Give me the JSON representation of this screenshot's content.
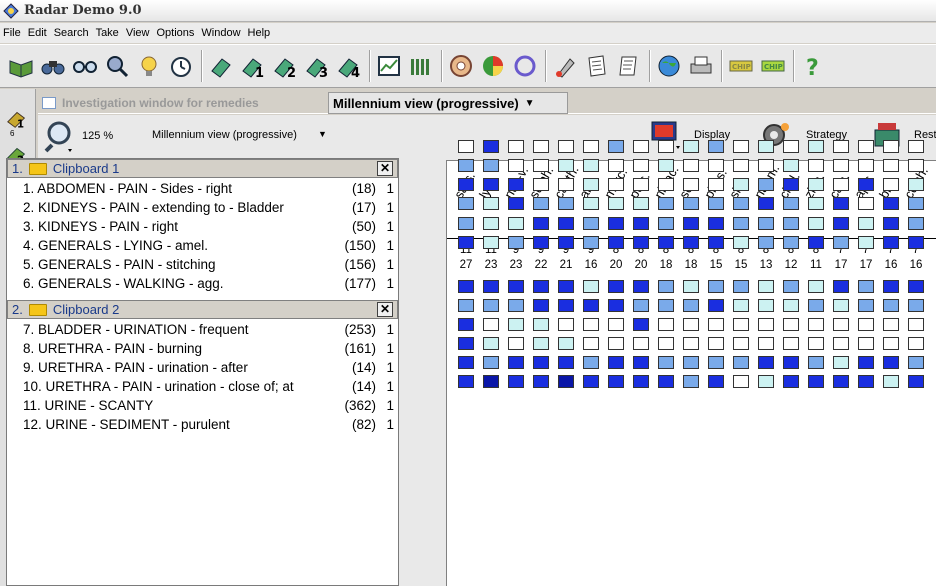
{
  "window": {
    "title": "Radar Demo 9.0"
  },
  "menu": [
    "File",
    "Edit",
    "Search",
    "Take",
    "View",
    "Options",
    "Window",
    "Help"
  ],
  "tabs": {
    "investigation": "Investigation window for remedies",
    "millennium": "Millennium view (progressive)"
  },
  "view": {
    "zoom": "125 %",
    "selector": "Millennium view (progressive)",
    "display_label": "Display",
    "strategy_label": "Strategy",
    "restrict_label": "Rest"
  },
  "leftbar": {
    "counts": [
      "6",
      "6"
    ],
    "numbers": [
      "1",
      "2",
      "3",
      "4",
      "5",
      "6",
      "7",
      "8",
      "9",
      "10"
    ]
  },
  "clipboards": [
    {
      "number": "1.",
      "name": "Clipboard 1",
      "close": "✕",
      "rubrics": [
        {
          "text": "1. ABDOMEN - PAIN - Sides - right",
          "count": "(18)",
          "weight": "1"
        },
        {
          "text": "2. KIDNEYS - PAIN - extending to - Bladder",
          "count": "(17)",
          "weight": "1"
        },
        {
          "text": "3. KIDNEYS - PAIN - right",
          "count": "(50)",
          "weight": "1"
        },
        {
          "text": "4. GENERALS - LYING - amel.",
          "count": "(150)",
          "weight": "1"
        },
        {
          "text": "5. GENERALS - PAIN - stitching",
          "count": "(156)",
          "weight": "1"
        },
        {
          "text": "6. GENERALS - WALKING - agg.",
          "count": "(177)",
          "weight": "1"
        }
      ]
    },
    {
      "number": "2.",
      "name": "Clipboard 2",
      "close": "✕",
      "rubrics": [
        {
          "text": "7. BLADDER - URINATION - frequent",
          "count": "(253)",
          "weight": "1"
        },
        {
          "text": "8. URETHRA - PAIN - burning",
          "count": "(161)",
          "weight": "1"
        },
        {
          "text": "9. URETHRA - PAIN - urination - after",
          "count": "(14)",
          "weight": "1"
        },
        {
          "text": "10. URETHRA - PAIN - urination - close of; at",
          "count": "(14)",
          "weight": "1"
        },
        {
          "text": "11. URINE - SCANTY",
          "count": "(362)",
          "weight": "1"
        },
        {
          "text": "12. URINE - SEDIMENT - purulent",
          "count": "(82)",
          "weight": "1"
        }
      ]
    }
  ],
  "remedies": [
    {
      "name": "sars.",
      "rank": "1",
      "hits": "11",
      "score": "27"
    },
    {
      "name": "lyc.",
      "rank": "2",
      "hits": "11",
      "score": "23"
    },
    {
      "name": "nux-v.",
      "rank": "3",
      "hits": "9",
      "score": "23"
    },
    {
      "name": "sulph.",
      "rank": "4",
      "hits": "9",
      "score": "22"
    },
    {
      "name": "canth.",
      "rank": "5",
      "hits": "9",
      "score": "21"
    },
    {
      "name": "ars.",
      "rank": "6",
      "hits": "9",
      "score": "16"
    },
    {
      "name": "merc.",
      "rank": "7",
      "hits": "8",
      "score": "20"
    },
    {
      "name": "puls.",
      "rank": "8",
      "hits": "8",
      "score": "20"
    },
    {
      "name": "nit-ac.",
      "rank": "9",
      "hits": "8",
      "score": "18"
    },
    {
      "name": "sep.",
      "rank": "10",
      "hits": "8",
      "score": "18"
    },
    {
      "name": "phos.",
      "rank": "11",
      "hits": "8",
      "score": "15"
    },
    {
      "name": "sil.",
      "rank": "12",
      "hits": "8",
      "score": "15"
    },
    {
      "name": "nat-m.",
      "rank": "13",
      "hits": "8",
      "score": "13"
    },
    {
      "name": "chel.",
      "rank": "14",
      "hits": "8",
      "score": "12"
    },
    {
      "name": "zinc.",
      "rank": "15",
      "hits": "8",
      "score": "11"
    },
    {
      "name": "calc.",
      "rank": "16",
      "hits": "7",
      "score": "17"
    },
    {
      "name": "apis",
      "rank": "17",
      "hits": "7",
      "score": "17"
    },
    {
      "name": "bry.",
      "rank": "18",
      "hits": "7",
      "score": "16"
    },
    {
      "name": "colch.",
      "rank": "19",
      "hits": "7",
      "score": "16"
    }
  ],
  "grade_colors": [
    "#ffffff",
    "#ccf2f2",
    "#7aaaea",
    "#1a2ee0",
    "#0a16a8"
  ],
  "grid": [
    [
      0,
      3,
      0,
      0,
      0,
      0,
      2,
      0,
      0,
      1,
      2,
      0,
      1,
      0,
      1,
      0,
      0,
      0,
      0
    ],
    [
      2,
      2,
      0,
      0,
      1,
      1,
      0,
      0,
      1,
      0,
      0,
      0,
      0,
      1,
      0,
      0,
      0,
      0,
      0
    ],
    [
      3,
      3,
      3,
      0,
      0,
      1,
      0,
      0,
      0,
      0,
      0,
      1,
      2,
      3,
      1,
      0,
      3,
      0,
      1
    ],
    [
      2,
      1,
      3,
      2,
      2,
      1,
      1,
      1,
      2,
      2,
      2,
      2,
      3,
      2,
      1,
      3,
      0,
      3,
      2
    ],
    [
      2,
      1,
      1,
      3,
      3,
      2,
      3,
      3,
      2,
      3,
      3,
      2,
      2,
      2,
      1,
      3,
      1,
      3,
      2
    ],
    [
      3,
      1,
      2,
      3,
      3,
      2,
      3,
      3,
      3,
      3,
      3,
      1,
      2,
      2,
      3,
      2,
      1,
      3,
      3
    ],
    [
      3,
      3,
      3,
      3,
      3,
      1,
      3,
      3,
      2,
      1,
      2,
      2,
      1,
      2,
      1,
      3,
      2,
      3,
      3
    ],
    [
      2,
      2,
      2,
      3,
      3,
      3,
      3,
      2,
      2,
      2,
      3,
      1,
      1,
      1,
      2,
      1,
      2,
      2,
      2
    ],
    [
      3,
      0,
      1,
      1,
      0,
      0,
      0,
      3,
      0,
      0,
      0,
      0,
      0,
      0,
      0,
      0,
      0,
      0,
      0
    ],
    [
      3,
      1,
      0,
      1,
      1,
      0,
      0,
      0,
      0,
      0,
      0,
      0,
      0,
      0,
      0,
      0,
      0,
      0,
      0
    ],
    [
      3,
      2,
      3,
      3,
      3,
      2,
      3,
      3,
      2,
      2,
      2,
      2,
      3,
      3,
      2,
      1,
      3,
      3,
      2
    ],
    [
      3,
      4,
      3,
      3,
      4,
      3,
      3,
      3,
      3,
      2,
      3,
      0,
      1,
      3,
      3,
      3,
      3,
      1,
      3
    ]
  ]
}
